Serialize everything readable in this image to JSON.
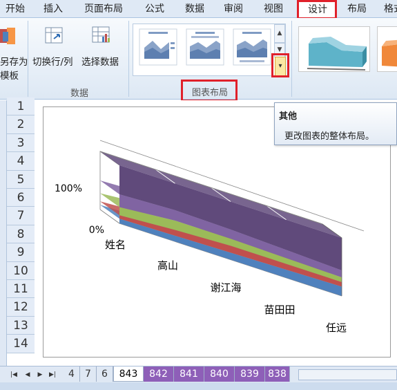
{
  "ribbon_tabs": [
    "开始",
    "插入",
    "页面布局",
    "公式",
    "数据",
    "审阅",
    "视图",
    "设计",
    "布局",
    "格式"
  ],
  "ribbon": {
    "save_template_label_line1": "另存为",
    "save_template_label_line2": "模板",
    "switch_row_col_label": "切换行/列",
    "select_data_label": "选择数据",
    "data_group_label": "数据",
    "chart_layouts_group_label": "图表布局"
  },
  "tooltip": {
    "title": "其他",
    "body": "更改图表的整体布局。"
  },
  "rows": [
    "1",
    "2",
    "3",
    "4",
    "5",
    "6",
    "7",
    "8",
    "9",
    "10",
    "11",
    "12",
    "13",
    "14"
  ],
  "chart_data": {
    "type": "area",
    "stacking": "percent",
    "categories": [
      "姓名",
      "高山",
      "谢江海",
      "苗田田",
      "任远"
    ],
    "y_tick_labels": [
      "100%",
      "0%"
    ],
    "ylim": [
      0,
      100
    ],
    "series": [
      {
        "color": "#4f81bd",
        "values": [
          8,
          10,
          12,
          14,
          16
        ]
      },
      {
        "color": "#c0504d",
        "values": [
          6,
          10,
          12,
          10,
          8
        ]
      },
      {
        "color": "#9bbb59",
        "values": [
          14,
          16,
          12,
          10,
          8
        ]
      },
      {
        "color": "#8064a2",
        "values": [
          22,
          18,
          16,
          14,
          12
        ]
      },
      {
        "color": "#604a7b",
        "values": [
          50,
          46,
          48,
          52,
          56
        ]
      }
    ],
    "grid": true,
    "legend": "none"
  },
  "sheet_tabs": [
    "4",
    "7",
    "6",
    "843",
    "842",
    "841",
    "840",
    "839",
    "838"
  ],
  "active_sheet": "843",
  "colors": {
    "accent_red": "#e0202a",
    "tab_purple": "#8e5fb8"
  }
}
